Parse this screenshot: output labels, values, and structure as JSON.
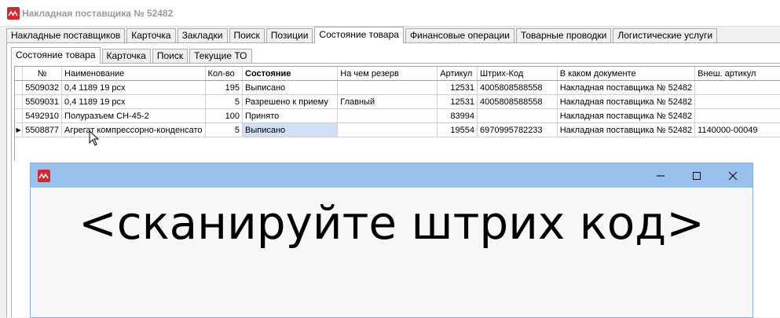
{
  "window": {
    "title": "Накладная поставщика № 52482"
  },
  "main_tabs": [
    {
      "label": "Накладные поставщиков"
    },
    {
      "label": "Карточка"
    },
    {
      "label": "Закладки"
    },
    {
      "label": "Поиск"
    },
    {
      "label": "Позиции"
    },
    {
      "label": "Состояние товара"
    },
    {
      "label": "Финансовые операции"
    },
    {
      "label": "Товарные проводки"
    },
    {
      "label": "Логистические услуги"
    }
  ],
  "sub_tabs": [
    {
      "label": "Состояние товара"
    },
    {
      "label": "Карточка"
    },
    {
      "label": "Поиск"
    },
    {
      "label": "Текущие ТО"
    }
  ],
  "grid": {
    "columns": [
      "№",
      "Наименование",
      "Кол-во",
      "Состояние",
      "На чем резерв",
      "Артикул",
      "Штрих-Код",
      "В каком документе",
      "Внеш. артикул"
    ],
    "rows": [
      {
        "indicator": "",
        "id": "5509032",
        "name": "0,4 1189 19 рсх",
        "qty": "195",
        "state": "Выписано",
        "reserve": "",
        "article": "12531",
        "barcode": "4005808588558",
        "document": "Накладная поставщика № 52482",
        "ext_article": ""
      },
      {
        "indicator": "",
        "id": "5509031",
        "name": "0,4 1189 19 рсх",
        "qty": "5",
        "state": "Разрешено к приему",
        "reserve": "Главный",
        "article": "12531",
        "barcode": "4005808588558",
        "document": "Накладная поставщика № 52482",
        "ext_article": ""
      },
      {
        "indicator": "",
        "id": "5492910",
        "name": "Полуразъем СН-45-2",
        "qty": "100",
        "state": "Принято",
        "reserve": "",
        "article": "83994",
        "barcode": "",
        "document": "Накладная поставщика № 52482",
        "ext_article": ""
      },
      {
        "indicator": "▶",
        "id": "5508877",
        "name": "Агрегат компрессорно-конденсато",
        "qty": "5",
        "state": "Выписано",
        "reserve": "",
        "article": "19554",
        "barcode": "6970995782233",
        "document": "Накладная поставщика № 52482",
        "ext_article": "1140000-00049"
      }
    ]
  },
  "dialog": {
    "title": "",
    "prompt": "<сканируйте штрих код>",
    "minimize_label": "—",
    "maximize_label": "☐",
    "close_label": "✕"
  },
  "colors": {
    "accent": "#d9262b",
    "dialog_title": "#99c1ee",
    "selection": "#cfe0f7"
  }
}
